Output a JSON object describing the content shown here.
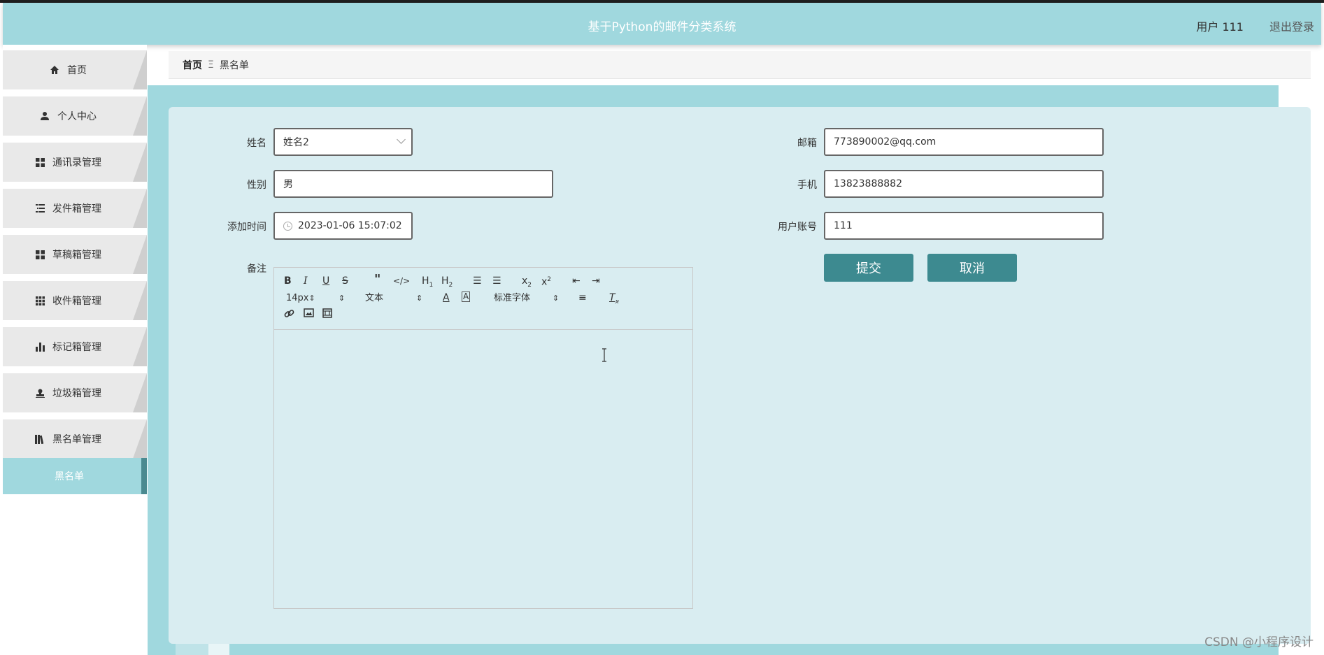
{
  "header": {
    "title": "基于Python的邮件分类系统",
    "user_label": "用户 111",
    "logout_label": "退出登录"
  },
  "sidebar": {
    "items": [
      {
        "label": "首页",
        "icon": "home-icon"
      },
      {
        "label": "个人中心",
        "icon": "user-icon"
      },
      {
        "label": "通讯录管理",
        "icon": "grid-icon"
      },
      {
        "label": "发件箱管理",
        "icon": "list-icon"
      },
      {
        "label": "草稿箱管理",
        "icon": "grid-icon"
      },
      {
        "label": "收件箱管理",
        "icon": "apps-icon"
      },
      {
        "label": "标记箱管理",
        "icon": "bar-chart-icon"
      },
      {
        "label": "垃圾箱管理",
        "icon": "stamp-icon"
      },
      {
        "label": "黑名单管理",
        "icon": "book-icon"
      }
    ],
    "active_sub_item": "黑名单"
  },
  "breadcrumb": {
    "home": "首页",
    "separator": "Ξ",
    "current": "黑名单"
  },
  "form": {
    "name": {
      "label": "姓名",
      "value": "姓名2"
    },
    "gender": {
      "label": "性别",
      "value": "男"
    },
    "added_time": {
      "label": "添加时间",
      "value": "2023-01-06 15:07:02"
    },
    "notes": {
      "label": "备注"
    },
    "email": {
      "label": "邮箱",
      "value": "773890002@qq.com"
    },
    "phone": {
      "label": "手机",
      "value": "13823888882"
    },
    "account": {
      "label": "用户账号",
      "value": "111"
    },
    "submit_label": "提交",
    "cancel_label": "取消"
  },
  "editor_toolbar": {
    "font_size": "14px",
    "block_type": "文本",
    "font_family": "标准字体"
  },
  "colors": {
    "header_bg": "#a0d8de",
    "button_bg": "#3d8a90",
    "card_bg": "#d9edf1"
  },
  "watermark": "CSDN @小程序设计"
}
